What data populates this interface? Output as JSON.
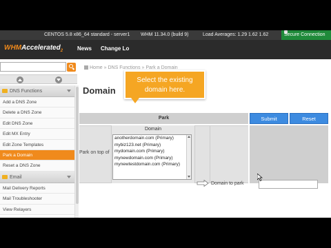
{
  "status_bar": {
    "os": "CENTOS 5.8 x86_64 standard - server1",
    "whm_version": "WHM 11.34.0 (build 9)",
    "load": "Load Averages: 1.29 1.62 1.62",
    "secure": "Secure Connection"
  },
  "header": {
    "logo_main": "WHM",
    "logo_accent": "Accelerated",
    "logo_sub": "2",
    "nav": [
      "News",
      "Change Lo"
    ]
  },
  "sidebar": {
    "search_placeholder": "",
    "section_dns": "DNS Functions",
    "dns_items": [
      "Add a DNS Zone",
      "Delete a DNS Zone",
      "Edit DNS Zone",
      "Edit MX Entry",
      "Edit Zone Templates",
      "Park a Domain",
      "Reset a DNS Zone"
    ],
    "section_email": "Email",
    "email_items": [
      "Mail Delivery Reports",
      "Mail Troubleshooter",
      "View Relayers"
    ]
  },
  "breadcrumb": {
    "home": "Home",
    "sep1": "»",
    "dns": "DNS Functions",
    "sep2": "»",
    "current": "Park a Domain"
  },
  "main": {
    "title": "Domain",
    "table_header": "Park",
    "submit_label": "Submit",
    "reset_label": "Reset",
    "park_label": "Park on top of",
    "domain_col_header": "Domain",
    "domains": [
      "anotherdomain.com (Primary)",
      "mybiz123.net (Primary)",
      "mydomain.com (Primary)",
      "mynewdomain.com (Primary)",
      "mynewtestdomain.com (Primary)"
    ],
    "domain_to_park_label": "Domain to park",
    "target_value": ""
  },
  "callout": {
    "line1": "Select the existing",
    "line2": "domain here."
  },
  "colors": {
    "accent": "#f08a1c",
    "button": "#3d8be0",
    "callout": "#f5a623"
  }
}
